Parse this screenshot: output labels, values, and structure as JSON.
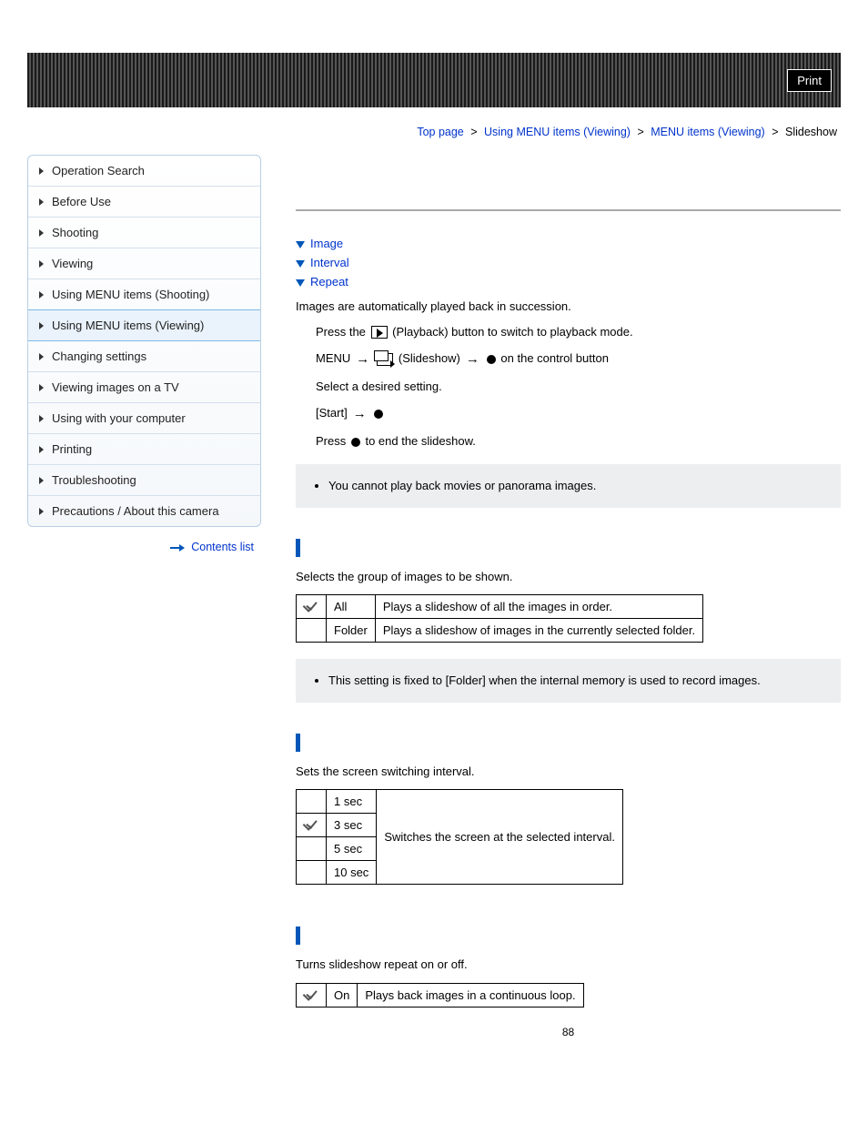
{
  "header": {
    "print_label": "Print"
  },
  "breadcrumb": {
    "items": [
      {
        "label": "Top page"
      },
      {
        "label": "Using MENU items (Viewing)"
      },
      {
        "label": "MENU items (Viewing)"
      }
    ],
    "current": "Slideshow",
    "sep": ">"
  },
  "sidebar": {
    "items": [
      {
        "label": "Operation Search"
      },
      {
        "label": "Before Use"
      },
      {
        "label": "Shooting"
      },
      {
        "label": "Viewing"
      },
      {
        "label": "Using MENU items (Shooting)"
      },
      {
        "label": "Using MENU items (Viewing)",
        "active": true
      },
      {
        "label": "Changing settings"
      },
      {
        "label": "Viewing images on a TV"
      },
      {
        "label": "Using with your computer"
      },
      {
        "label": "Printing"
      },
      {
        "label": "Troubleshooting"
      },
      {
        "label": "Precautions / About this camera"
      }
    ],
    "contents_list_label": "Contents list"
  },
  "anchors": {
    "image": "Image",
    "interval": "Interval",
    "repeat": "Repeat"
  },
  "intro": "Images are automatically played back in succession.",
  "steps": {
    "s1a": "Press the ",
    "s1b": " (Playback) button to switch to playback mode.",
    "s2a": "MENU",
    "s2b": " (Slideshow)",
    "s2c": " on the control button",
    "s3": "Select a desired setting.",
    "s4": "[Start]",
    "s5a": "Press ",
    "s5b": " to end the slideshow."
  },
  "note1": "You cannot play back movies or panorama images.",
  "image_section": {
    "desc": "Selects the group of images to be shown.",
    "rows": [
      {
        "check": true,
        "name": "All",
        "desc": "Plays a slideshow of all the images in order."
      },
      {
        "check": false,
        "name": "Folder",
        "desc": "Plays a slideshow of images in the currently selected folder."
      }
    ],
    "note": "This setting is fixed to [Folder] when the internal memory is used to record images."
  },
  "interval_section": {
    "desc": "Sets the screen switching interval.",
    "rows": [
      {
        "check": false,
        "name": "1 sec"
      },
      {
        "check": true,
        "name": "3 sec"
      },
      {
        "check": false,
        "name": "5 sec"
      },
      {
        "check": false,
        "name": "10 sec"
      }
    ],
    "row_desc": "Switches the screen at the selected interval."
  },
  "repeat_section": {
    "desc": "Turns slideshow repeat on or off.",
    "rows": [
      {
        "check": true,
        "name": "On",
        "desc": "Plays back images in a continuous loop."
      }
    ]
  },
  "page_number": "88"
}
